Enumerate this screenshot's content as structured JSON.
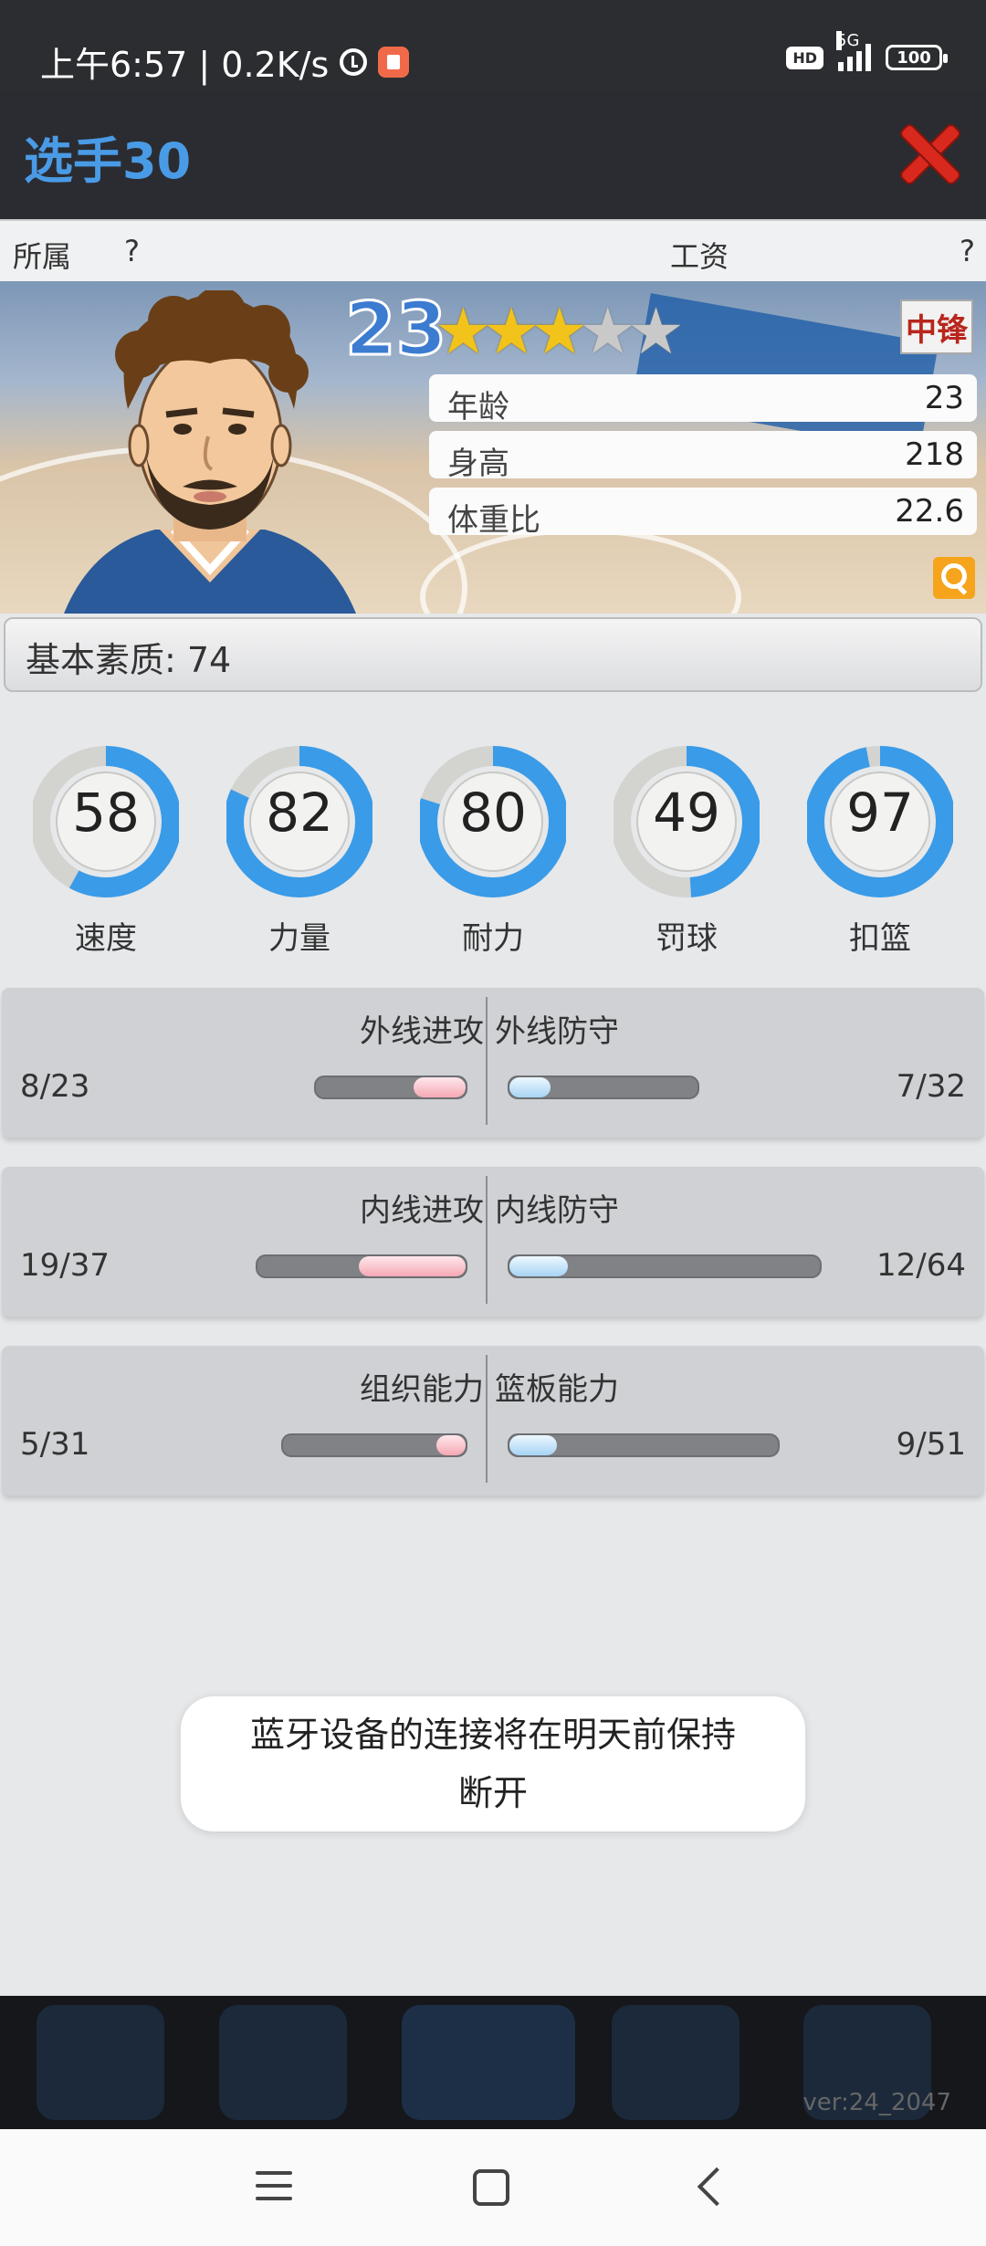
{
  "status_bar": {
    "time_speed": "上午6:57 | 0.2K/s",
    "hd": "HD",
    "network": "5G",
    "battery": "100"
  },
  "header": {
    "title": "选手30"
  },
  "info": {
    "team_label": "所属",
    "team_value": "?",
    "salary_label": "工资",
    "salary_value": "?"
  },
  "player": {
    "number": "23",
    "stars_filled": 3,
    "stars_total": 5,
    "position": "中锋",
    "stats": [
      {
        "label": "年龄",
        "value": "23"
      },
      {
        "label": "身高",
        "value": "218"
      },
      {
        "label": "体重比",
        "value": "22.6"
      }
    ]
  },
  "base_quality": "基本素质: 74",
  "attributes": [
    {
      "label": "速度",
      "value": 58
    },
    {
      "label": "力量",
      "value": 82
    },
    {
      "label": "耐力",
      "value": 80
    },
    {
      "label": "罚球",
      "value": 49
    },
    {
      "label": "扣篮",
      "value": 97
    }
  ],
  "abilities": [
    {
      "left_title": "外线进攻",
      "left_value": "8/23",
      "right_title": "外线防守",
      "right_value": "7/32"
    },
    {
      "left_title": "内线进攻",
      "left_value": "19/37",
      "right_title": "内线防守",
      "right_value": "12/64"
    },
    {
      "left_title": "组织能力",
      "left_value": "5/31",
      "right_title": "篮板能力",
      "right_value": "9/51"
    }
  ],
  "toast": {
    "line1": "蓝牙设备的连接将在明天前保持",
    "line2": "断开"
  },
  "version": "ver:24_2047",
  "colors": {
    "title_blue": "#4a9be6",
    "ring_blue": "#3a9be8",
    "close_red": "#d9291e",
    "position_red": "#b8261c"
  }
}
